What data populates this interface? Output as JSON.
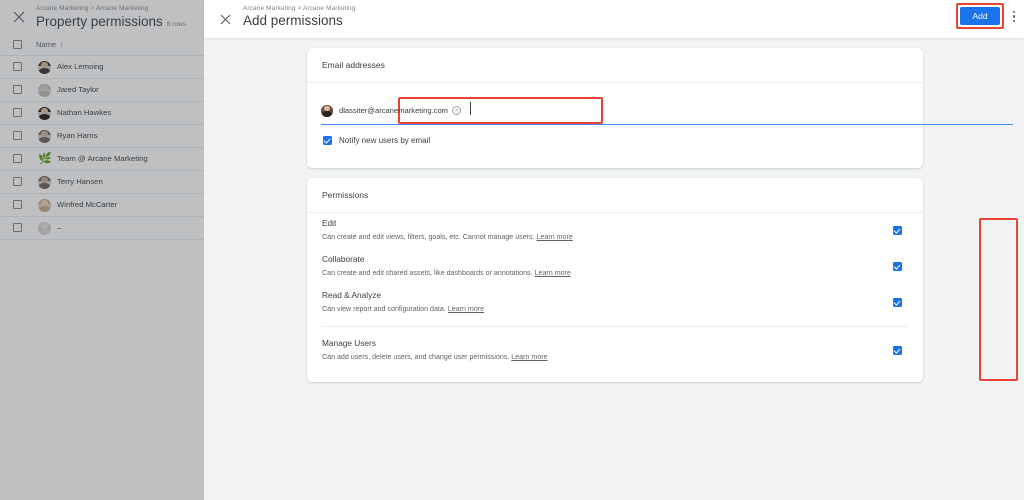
{
  "background_page": {
    "close_icon": "close-icon",
    "breadcrumb": "Arcane Marketing > Arcane Marketing",
    "title": "Property permissions",
    "row_count_label": "8 rows",
    "column_header": "Name",
    "sort_arrow": "↑",
    "rows": [
      {
        "name": "Alex Lemoing",
        "avatar_icon": "person-avatar",
        "c1": "#3b2f2a",
        "c2": "#d9b9a2"
      },
      {
        "name": "Jared Taylor",
        "avatar_icon": "person-avatar",
        "c1": "#b9bcae",
        "c2": "#cfd2c6"
      },
      {
        "name": "Nathan Hawkes",
        "avatar_icon": "person-avatar",
        "c1": "#1f1a16",
        "c2": "#e3c3ab"
      },
      {
        "name": "Ryan Harris",
        "avatar_icon": "person-avatar",
        "c1": "#6f635b",
        "c2": "#cbb6a6"
      },
      {
        "name": "Team @ Arcane Marketing",
        "avatar_icon": "leaf-icon",
        "c1": "#4caf50",
        "c2": "#8bc34a"
      },
      {
        "name": "Terry Hansen",
        "avatar_icon": "person-avatar",
        "c1": "#6e6157",
        "c2": "#c4ab98"
      },
      {
        "name": "Winfred McCarter",
        "avatar_icon": "person-avatar",
        "c1": "#c9a97e",
        "c2": "#e8d6bf"
      },
      {
        "name": "–",
        "avatar_icon": "generic-avatar",
        "c1": "#d6d6d6",
        "c2": "#e4e4e4"
      }
    ]
  },
  "panel": {
    "close_icon": "close-icon",
    "breadcrumb": "Arcane Marketing > Arcane Marketing",
    "title": "Add permissions",
    "add_label": "Add",
    "more_icon": "kebab-menu-icon",
    "accent_color": "#1a73e8",
    "highlight_color": "#ea4335"
  },
  "email_card": {
    "header": "Email addresses",
    "chip": {
      "email": "dlassiter@arcanemarketing.com",
      "remove_icon": "×",
      "avatar_icon": "person-avatar"
    },
    "input_placeholder": "",
    "notify": {
      "label": "Notify new users by email",
      "checked": true
    }
  },
  "permissions_card": {
    "header": "Permissions",
    "rows": [
      {
        "title": "Edit",
        "description": "Can create and edit views, filters, goals, etc. Cannot manage users.",
        "learn_more": "Learn more",
        "checked": true
      },
      {
        "title": "Collaborate",
        "description": "Can create and edit shared assets, like dashboards or annotations.",
        "learn_more": "Learn more",
        "checked": true
      },
      {
        "title": "Read & Analyze",
        "description": "Can view report and configuration data.",
        "learn_more": "Learn more",
        "checked": true
      },
      {
        "title": "Manage Users",
        "description": "Can add users, delete users, and change user permissions.",
        "learn_more": "Learn more",
        "checked": true
      }
    ]
  }
}
